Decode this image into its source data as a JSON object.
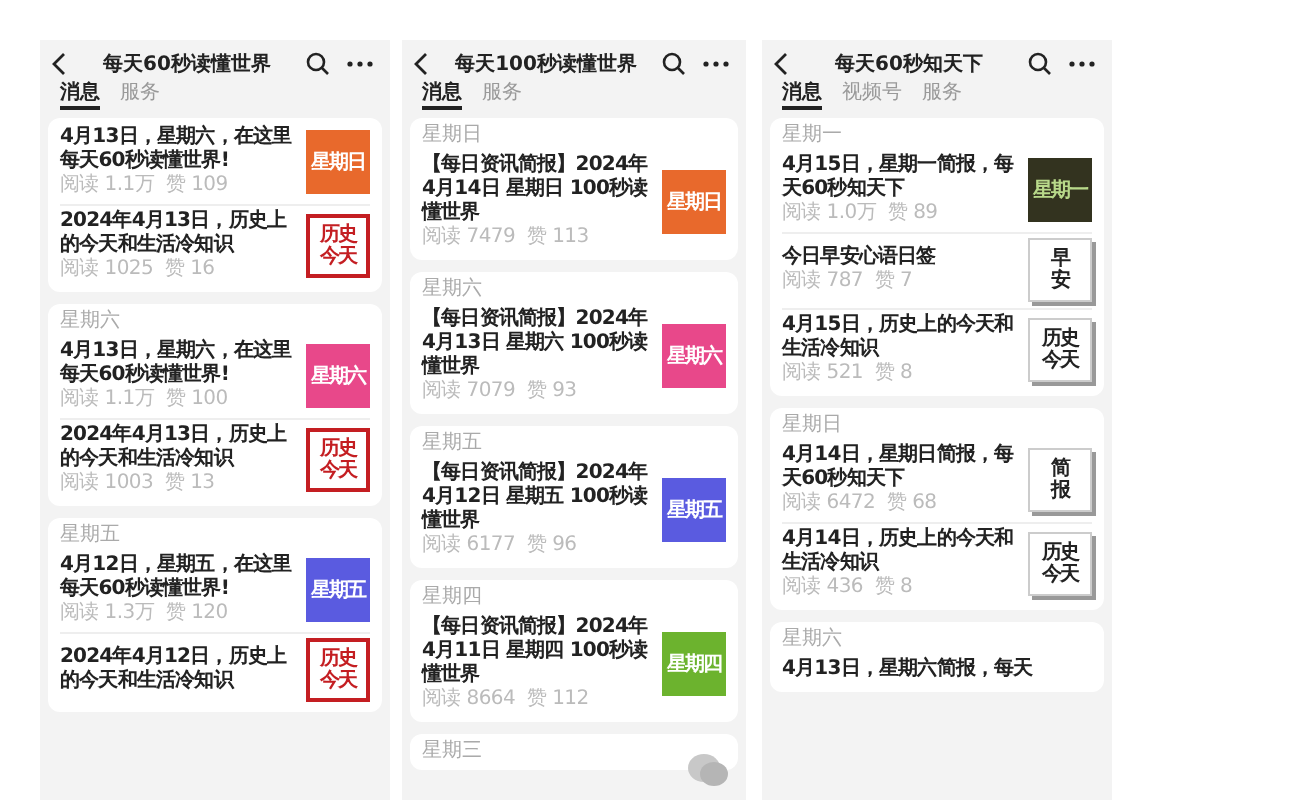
{
  "panels": [
    {
      "title": "每天60秒读懂世界",
      "tabs": [
        {
          "label": "消息",
          "selected": true
        },
        {
          "label": "服务",
          "selected": false
        }
      ],
      "groups": [
        {
          "items": [
            {
              "title": "4月13日，星期六，在这里每天60秒读懂世界!",
              "reads": "阅读 1.1万",
              "likes": "赞 109",
              "thumb": {
                "kind": "solid",
                "color": "#e8692c",
                "lines": [
                  "星期日"
                ]
              }
            },
            {
              "title": "2024年4月13日，历史上的今天和生活冷知识",
              "reads": "阅读 1025",
              "likes": "赞 16",
              "thumb": {
                "kind": "seal",
                "color": "#c41e22",
                "lines": [
                  "历史",
                  "今天"
                ]
              }
            }
          ]
        },
        {
          "day": "星期六",
          "items": [
            {
              "title": "4月13日，星期六，在这里每天60秒读懂世界!",
              "reads": "阅读 1.1万",
              "likes": "赞 100",
              "thumb": {
                "kind": "solid",
                "color": "#e8488a",
                "lines": [
                  "星期六"
                ]
              }
            },
            {
              "title": "2024年4月13日，历史上的今天和生活冷知识",
              "reads": "阅读 1003",
              "likes": "赞 13",
              "thumb": {
                "kind": "seal",
                "color": "#c41e22",
                "lines": [
                  "历史",
                  "今天"
                ]
              }
            }
          ]
        },
        {
          "day": "星期五",
          "items": [
            {
              "title": "4月12日，星期五，在这里每天60秒读懂世界!",
              "reads": "阅读 1.3万",
              "likes": "赞 120",
              "thumb": {
                "kind": "solid",
                "color": "#5a5be0",
                "lines": [
                  "星期五"
                ]
              }
            },
            {
              "title": "2024年4月12日，历史上的今天和生活冷知识",
              "thumb": {
                "kind": "seal",
                "color": "#c41e22",
                "lines": [
                  "历史",
                  "今天"
                ]
              }
            }
          ]
        }
      ]
    },
    {
      "title": "每天100秒读懂世界",
      "tabs": [
        {
          "label": "消息",
          "selected": true
        },
        {
          "label": "服务",
          "selected": false
        }
      ],
      "floating": true,
      "groups": [
        {
          "day": "星期日",
          "items": [
            {
              "title": "【每日资讯简报】2024年4月14日 星期日 100秒读懂世界",
              "reads": "阅读 7479",
              "likes": "赞 113",
              "thumb": {
                "kind": "solid",
                "color": "#e8692c",
                "lines": [
                  "星期日"
                ]
              }
            }
          ]
        },
        {
          "day": "星期六",
          "items": [
            {
              "title": "【每日资讯简报】2024年4月13日 星期六 100秒读懂世界",
              "reads": "阅读 7079",
              "likes": "赞 93",
              "thumb": {
                "kind": "solid",
                "color": "#e8488a",
                "lines": [
                  "星期六"
                ]
              }
            }
          ]
        },
        {
          "day": "星期五",
          "items": [
            {
              "title": "【每日资讯简报】2024年4月12日 星期五 100秒读懂世界",
              "reads": "阅读 6177",
              "likes": "赞 96",
              "thumb": {
                "kind": "solid",
                "color": "#5a5be0",
                "lines": [
                  "星期五"
                ]
              }
            }
          ]
        },
        {
          "day": "星期四",
          "items": [
            {
              "title": "【每日资讯简报】2024年4月11日 星期四 100秒读懂世界",
              "reads": "阅读 8664",
              "likes": "赞 112",
              "thumb": {
                "kind": "solid",
                "color": "#6cb32e",
                "lines": [
                  "星期四"
                ]
              }
            }
          ]
        },
        {
          "day": "星期三"
        }
      ]
    },
    {
      "title": "每天60秒知天下",
      "tabs": [
        {
          "label": "消息",
          "selected": true
        },
        {
          "label": "视频号",
          "selected": false
        },
        {
          "label": "服务",
          "selected": false
        }
      ],
      "groups": [
        {
          "day": "星期一",
          "items": [
            {
              "title": "4月15日，星期一简报，每天60秒知天下",
              "reads": "阅读 1.0万",
              "likes": "赞 89",
              "thumb": {
                "kind": "dark",
                "color": "#33331f",
                "lines": [
                  "星期一"
                ]
              }
            },
            {
              "title": "今日早安心语日签",
              "reads": "阅读 787",
              "likes": "赞 7",
              "thumb": {
                "kind": "card",
                "color": "#222222",
                "lines": [
                  "早",
                  "安"
                ]
              }
            },
            {
              "title": "4月15日，历史上的今天和生活冷知识",
              "reads": "阅读 521",
              "likes": "赞 8",
              "thumb": {
                "kind": "card",
                "color": "#222222",
                "lines": [
                  "历史",
                  "今天"
                ]
              }
            }
          ]
        },
        {
          "day": "星期日",
          "items": [
            {
              "title": "4月14日，星期日简报，每天60秒知天下",
              "reads": "阅读 6472",
              "likes": "赞 68",
              "thumb": {
                "kind": "card",
                "color": "#222222",
                "lines": [
                  "简",
                  "报"
                ]
              }
            },
            {
              "title": "4月14日，历史上的今天和生活冷知识",
              "reads": "阅读 436",
              "likes": "赞 8",
              "thumb": {
                "kind": "card",
                "color": "#222222",
                "lines": [
                  "历史",
                  "今天"
                ]
              }
            }
          ]
        },
        {
          "day": "星期六",
          "items": [
            {
              "title": "4月13日，星期六简报，每天"
            }
          ]
        }
      ]
    }
  ]
}
